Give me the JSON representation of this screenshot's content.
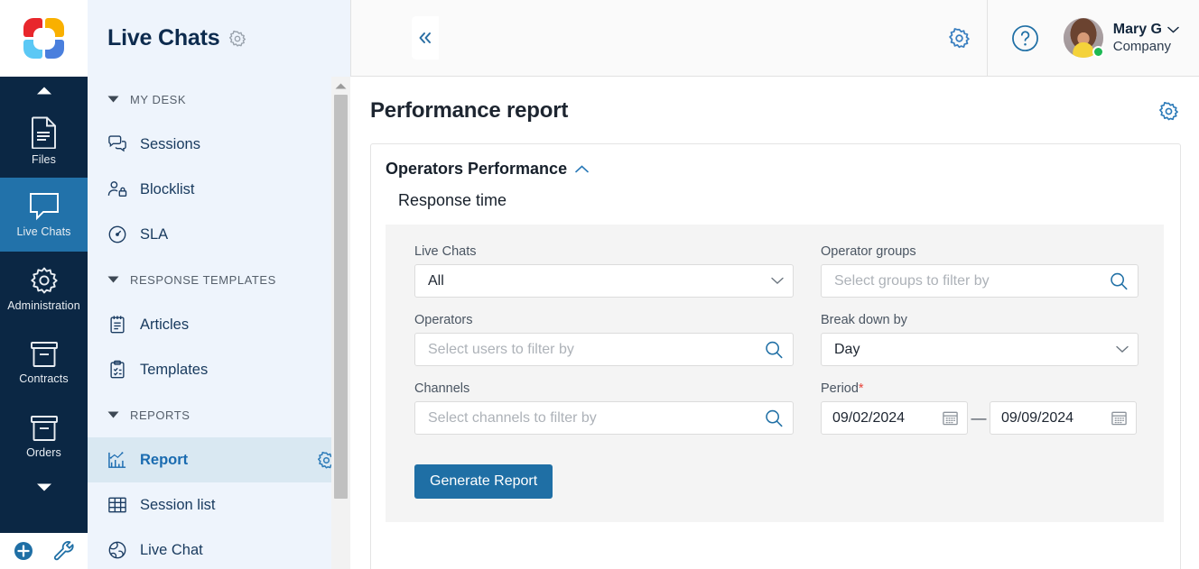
{
  "brand": {
    "logo_name": "app-logo",
    "colors": {
      "logo_red": "#e8272c",
      "logo_yellow": "#f9b000",
      "logo_blue": "#4a7fdd",
      "logo_cyan": "#5bc8f5",
      "accent": "#1f6fa5",
      "rail_bg": "#0b2744",
      "panel_bg": "#eef4fc",
      "active_rail": "#2272aa",
      "active_nav": "#d9e8f2",
      "required_red": "#e8453c",
      "online_green": "#1db954"
    }
  },
  "rail": {
    "scroll_up_icon": "caret-up-icon",
    "scroll_down_icon": "caret-down-icon",
    "items": [
      {
        "label": "Files",
        "icon": "file-icon",
        "active": false
      },
      {
        "label": "Live Chats",
        "icon": "chat-bubble-icon",
        "active": true
      },
      {
        "label": "Administration",
        "icon": "gear-icon",
        "active": false
      },
      {
        "label": "Contracts",
        "icon": "box-icon",
        "active": false
      },
      {
        "label": "Orders",
        "icon": "box-icon",
        "active": false
      }
    ],
    "bottom": [
      {
        "name": "add-button",
        "icon": "plus-circle-icon"
      },
      {
        "name": "tools-button",
        "icon": "wrench-icon"
      }
    ]
  },
  "panel": {
    "title": "Live Chats",
    "title_gear_icon": "gear-icon",
    "collapse_icon": "double-chevron-left-icon",
    "groups": [
      {
        "label": "MY DESK",
        "caret": "caret-down-icon",
        "items": [
          {
            "label": "Sessions",
            "icon": "chat-bubbles-icon",
            "active": false
          },
          {
            "label": "Blocklist",
            "icon": "user-lock-icon",
            "active": false
          },
          {
            "label": "SLA",
            "icon": "gauge-icon",
            "active": false
          }
        ]
      },
      {
        "label": "RESPONSE TEMPLATES",
        "caret": "caret-down-icon",
        "items": [
          {
            "label": "Articles",
            "icon": "notepad-icon",
            "active": false
          },
          {
            "label": "Templates",
            "icon": "clipboard-check-icon",
            "active": false
          }
        ]
      },
      {
        "label": "REPORTS",
        "caret": "caret-down-icon",
        "items": [
          {
            "label": "Report",
            "icon": "bar-chart-icon",
            "active": true,
            "trailing_icon": "gear-icon"
          },
          {
            "label": "Session list",
            "icon": "table-icon",
            "active": false
          },
          {
            "label": "Live Chat",
            "icon": "globe-chat-icon",
            "active": false
          }
        ]
      }
    ]
  },
  "topbar": {
    "settings_icon": "gear-icon",
    "help_icon": "question-circle-icon",
    "user": {
      "name": "Mary G",
      "org": "Company",
      "avatar_name": "avatar",
      "status": "online",
      "chevron_icon": "chevron-down-icon"
    }
  },
  "page": {
    "title": "Performance report",
    "settings_icon": "gear-icon",
    "section": {
      "title": "Operators Performance",
      "collapse_icon": "chevron-up-icon",
      "subtitle": "Response time"
    }
  },
  "form": {
    "live_chats": {
      "label": "Live Chats",
      "value": "All",
      "chevron_icon": "chevron-down-icon"
    },
    "operators": {
      "label": "Operators",
      "placeholder": "Select users to filter by",
      "search_icon": "search-icon"
    },
    "channels": {
      "label": "Channels",
      "placeholder": "Select channels to filter by",
      "search_icon": "search-icon"
    },
    "operator_groups": {
      "label": "Operator groups",
      "placeholder": "Select groups to filter by",
      "search_icon": "search-icon"
    },
    "break_down_by": {
      "label": "Break down by",
      "value": "Day",
      "chevron_icon": "chevron-down-icon"
    },
    "period": {
      "label": "Period",
      "required_mark": "*",
      "from": "09/02/2024",
      "to": "09/09/2024",
      "separator": "—",
      "calendar_icon": "calendar-icon"
    },
    "generate_button": "Generate Report"
  }
}
